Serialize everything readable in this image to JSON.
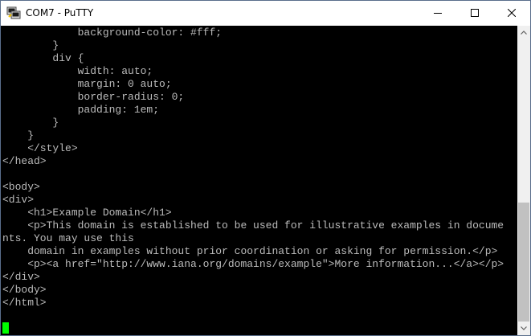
{
  "window": {
    "title": "COM7 - PuTTY"
  },
  "titlebar_buttons": {
    "minimize": "minimize",
    "maximize": "maximize",
    "close": "close"
  },
  "terminal": {
    "lines": [
      "            background-color: #fff;",
      "        }",
      "        div {",
      "            width: auto;",
      "            margin: 0 auto;",
      "            border-radius: 0;",
      "            padding: 1em;",
      "        }",
      "    }",
      "    </style>",
      "</head>",
      "",
      "<body>",
      "<div>",
      "    <h1>Example Domain</h1>",
      "    <p>This domain is established to be used for illustrative examples in docume",
      "nts. You may use this",
      "    domain in examples without prior coordination or asking for permission.</p>",
      "    <p><a href=\"http://www.iana.org/domains/example\">More information...</a></p>",
      "</div>",
      "</body>",
      "</html>"
    ]
  },
  "colors": {
    "terminal_bg": "#000000",
    "terminal_fg": "#bbbbbb",
    "cursor": "#00ff00"
  },
  "icons": {
    "app": "putty-icon",
    "scroll_up": "chevron-up-icon",
    "scroll_down": "chevron-down-icon"
  }
}
